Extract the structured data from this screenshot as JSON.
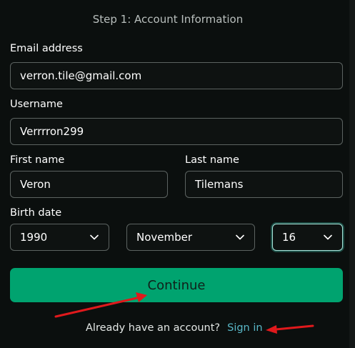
{
  "form": {
    "step_title": "Step 1: Account Information",
    "email": {
      "label": "Email address",
      "value": "verron.tile@gmail.com"
    },
    "username": {
      "label": "Username",
      "value": "Verrrron299"
    },
    "first_name": {
      "label": "First name",
      "value": "Veron"
    },
    "last_name": {
      "label": "Last name",
      "value": "Tilemans"
    },
    "birth_date": {
      "label": "Birth date",
      "year": "1990",
      "month": "November",
      "day": "16"
    },
    "continue_label": "Continue",
    "account_prompt": "Already have an account?",
    "signin_label": "Sign in"
  },
  "colors": {
    "background": "#0b0f0e",
    "primary_button": "#00a36f",
    "link": "#59b7c7",
    "annotation_arrow": "#e0191c"
  },
  "icons": [
    "chevron-down-icon",
    "annotation-arrow"
  ]
}
